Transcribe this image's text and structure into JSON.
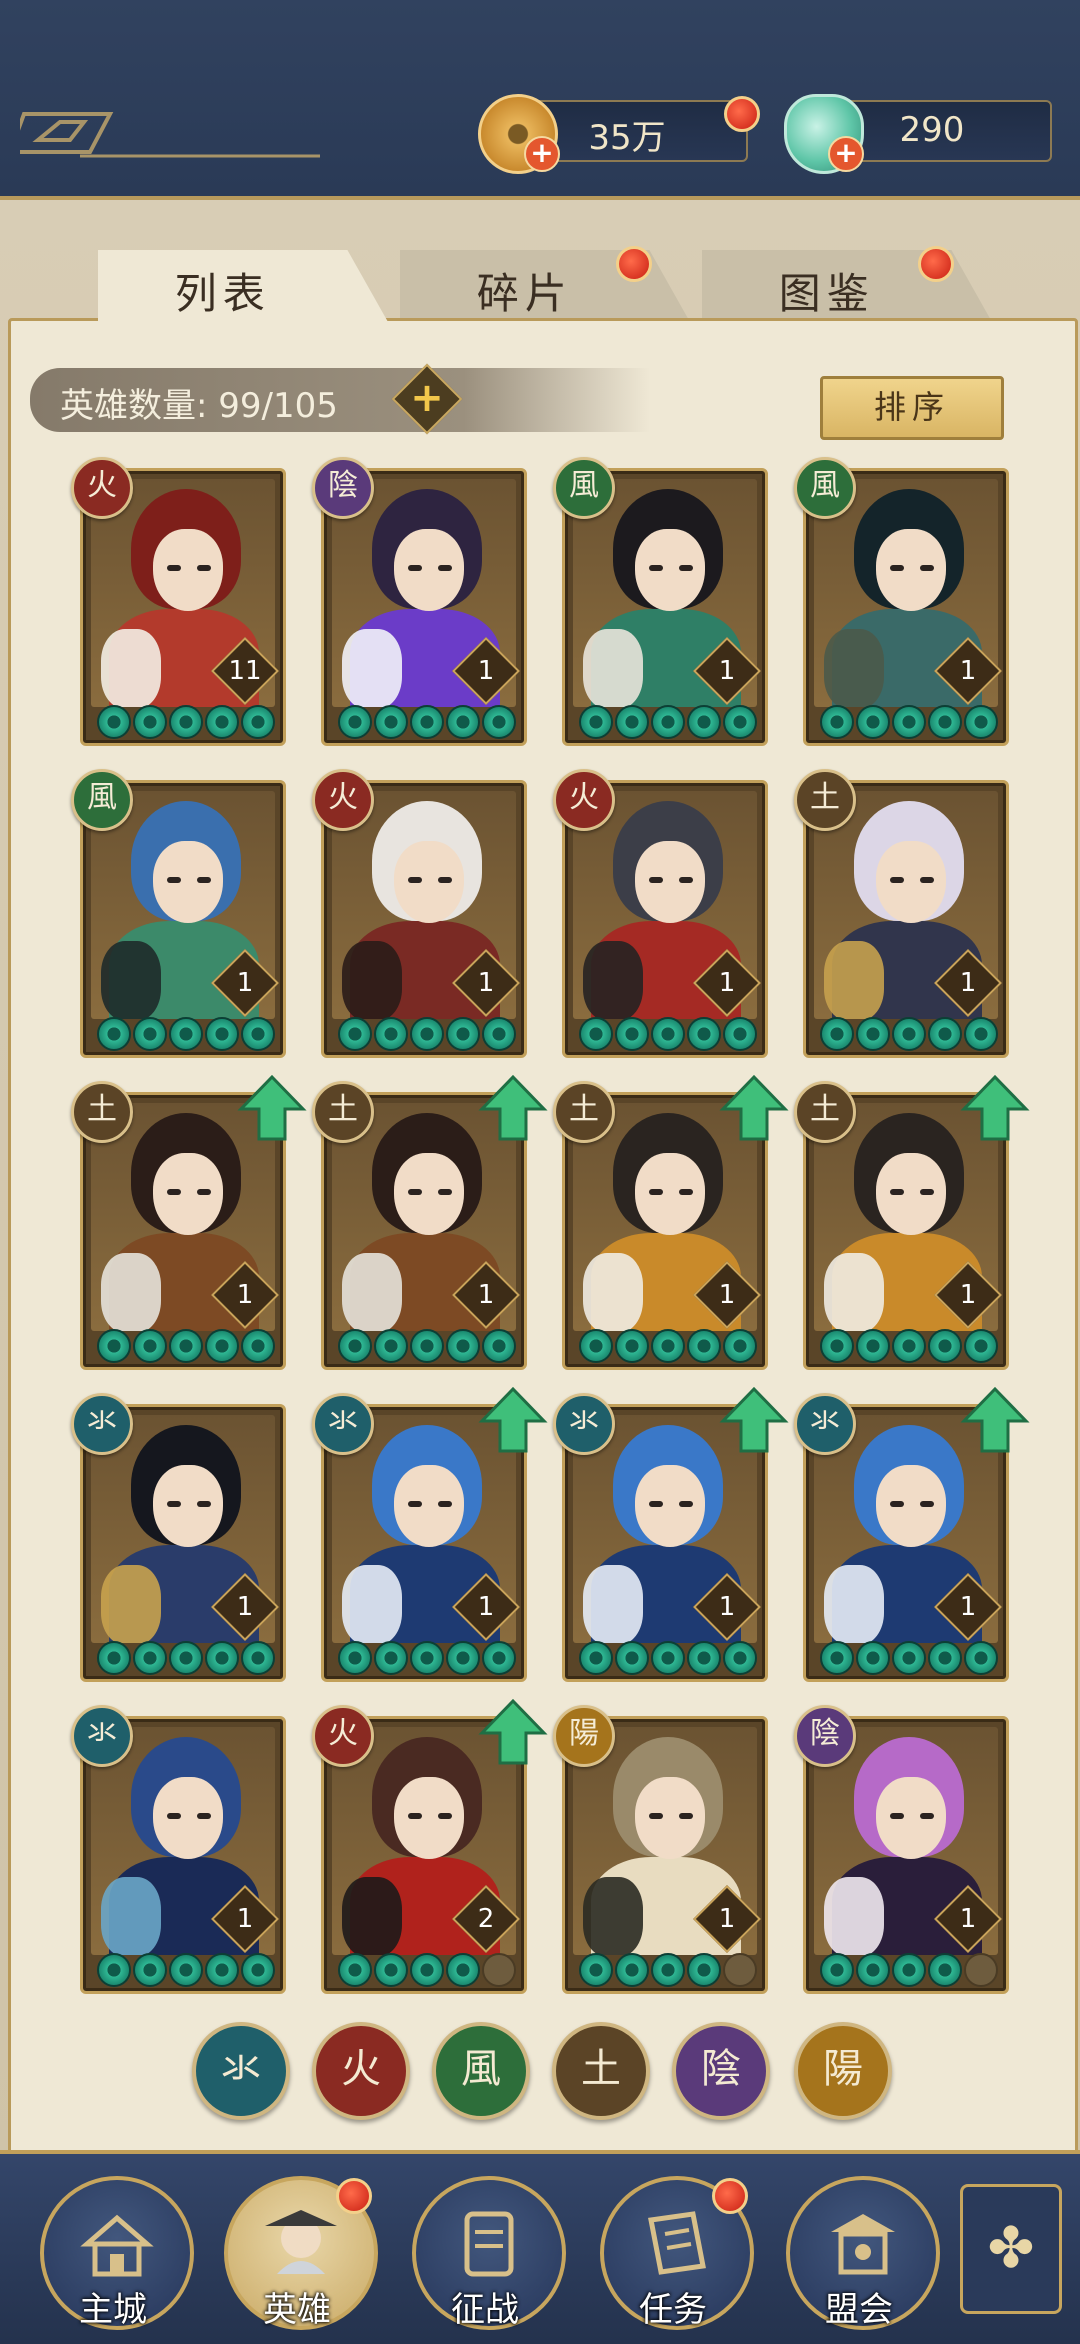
{
  "currencies": [
    {
      "name": "copper-coin",
      "value": "35万",
      "has_plus": true,
      "notify": true
    },
    {
      "name": "jade-shell",
      "value": "290",
      "has_plus": true,
      "notify": false
    }
  ],
  "tabs": [
    {
      "label": "列表",
      "active": true,
      "notify": false
    },
    {
      "label": "碎片",
      "active": false,
      "notify": true
    },
    {
      "label": "图鉴",
      "active": false,
      "notify": true
    }
  ],
  "hero_count": {
    "label": "英雄数量: 99/105"
  },
  "sort_label": "排序",
  "elements": {
    "water": {
      "glyph": "氺",
      "color": "#1f5f6a"
    },
    "fire": {
      "glyph": "火",
      "color": "#8a2a22"
    },
    "wind": {
      "glyph": "風",
      "color": "#2d6e3a"
    },
    "earth": {
      "glyph": "土",
      "color": "#5b4426"
    },
    "yin": {
      "glyph": "陰",
      "color": "#5a3a7a"
    },
    "yang": {
      "glyph": "陽",
      "color": "#a5741c"
    }
  },
  "heroes": [
    {
      "element": "fire",
      "level": "11",
      "stars": 5,
      "upgrade": false,
      "palette": [
        "#7e1f1a",
        "#b33a2c",
        "#f3eee4"
      ]
    },
    {
      "element": "yin",
      "level": "1",
      "stars": 5,
      "upgrade": false,
      "palette": [
        "#2e2440",
        "#6b3cc8",
        "#f2f2f8"
      ]
    },
    {
      "element": "wind",
      "level": "1",
      "stars": 5,
      "upgrade": false,
      "palette": [
        "#1c1a1e",
        "#2f7f66",
        "#e9e4da"
      ]
    },
    {
      "element": "wind",
      "level": "1",
      "stars": 5,
      "upgrade": false,
      "palette": [
        "#14242a",
        "#3a6a68",
        "#4b5a4a"
      ]
    },
    {
      "element": "wind",
      "level": "1",
      "stars": 5,
      "upgrade": false,
      "palette": [
        "#3a6fae",
        "#3c8a6a",
        "#1e2a2a"
      ]
    },
    {
      "element": "fire",
      "level": "1",
      "stars": 5,
      "upgrade": false,
      "palette": [
        "#e8e4df",
        "#7a2a24",
        "#2a1c18"
      ]
    },
    {
      "element": "fire",
      "level": "1",
      "stars": 5,
      "upgrade": false,
      "palette": [
        "#3c3e48",
        "#a52a24",
        "#262222"
      ]
    },
    {
      "element": "earth",
      "level": "1",
      "stars": 5,
      "upgrade": false,
      "palette": [
        "#dcd6e6",
        "#31354c",
        "#c6a14e"
      ]
    },
    {
      "element": "earth",
      "level": "1",
      "stars": 5,
      "upgrade": true,
      "palette": [
        "#2b1d18",
        "#7d4a24",
        "#e6e2da"
      ]
    },
    {
      "element": "earth",
      "level": "1",
      "stars": 5,
      "upgrade": true,
      "palette": [
        "#2b1d18",
        "#7d4a24",
        "#e6e2da"
      ]
    },
    {
      "element": "earth",
      "level": "1",
      "stars": 5,
      "upgrade": true,
      "palette": [
        "#2a2420",
        "#c98a2a",
        "#f0ebe2"
      ]
    },
    {
      "element": "earth",
      "level": "1",
      "stars": 5,
      "upgrade": true,
      "palette": [
        "#2a2420",
        "#c98a2a",
        "#f0ebe2"
      ]
    },
    {
      "element": "water",
      "level": "1",
      "stars": 5,
      "upgrade": false,
      "palette": [
        "#15171e",
        "#2a3c6a",
        "#c8a24e"
      ]
    },
    {
      "element": "water",
      "level": "1",
      "stars": 5,
      "upgrade": true,
      "palette": [
        "#3a78c8",
        "#1e3a72",
        "#e6ecf6"
      ]
    },
    {
      "element": "water",
      "level": "1",
      "stars": 5,
      "upgrade": true,
      "palette": [
        "#3a78c8",
        "#1e3a72",
        "#e6ecf6"
      ]
    },
    {
      "element": "water",
      "level": "1",
      "stars": 5,
      "upgrade": true,
      "palette": [
        "#3a78c8",
        "#1e3a72",
        "#e6ecf6"
      ]
    },
    {
      "element": "water",
      "level": "1",
      "stars": 5,
      "upgrade": false,
      "palette": [
        "#2a4a8a",
        "#1a2a56",
        "#6aa6c8"
      ]
    },
    {
      "element": "fire",
      "level": "2",
      "stars": 4,
      "upgrade": true,
      "palette": [
        "#4a2a22",
        "#b0221c",
        "#1e1a1a"
      ]
    },
    {
      "element": "yang",
      "level": "1",
      "stars": 4,
      "upgrade": false,
      "palette": [
        "#9a8a6a",
        "#e8dcc0",
        "#2a2a22"
      ]
    },
    {
      "element": "yin",
      "level": "1",
      "stars": 4,
      "upgrade": false,
      "palette": [
        "#b66ac8",
        "#2a1e3a",
        "#efe8ef"
      ]
    }
  ],
  "filters": [
    "water",
    "fire",
    "wind",
    "earth",
    "yin",
    "yang"
  ],
  "nav": [
    {
      "label": "主城",
      "icon": "castle-icon",
      "active": false,
      "notify": false
    },
    {
      "label": "英雄",
      "icon": "hero-portrait-icon",
      "active": true,
      "notify": true
    },
    {
      "label": "征战",
      "icon": "scroll-battle-icon",
      "active": false,
      "notify": false
    },
    {
      "label": "任务",
      "icon": "task-scroll-icon",
      "active": false,
      "notify": true
    },
    {
      "label": "盟会",
      "icon": "guild-pavilion-icon",
      "active": false,
      "notify": false
    }
  ],
  "side_button_icon": "menu-knot-icon"
}
